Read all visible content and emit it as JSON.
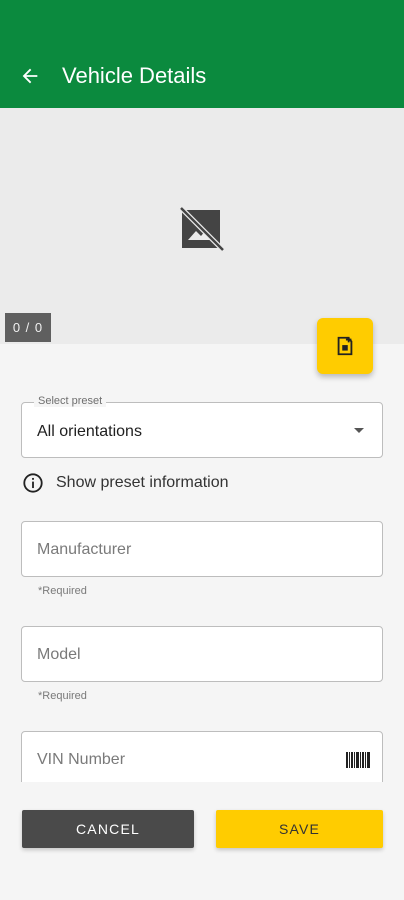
{
  "app_bar": {
    "title": "Vehicle Details",
    "back_icon": "arrow-back-icon",
    "color": "#0b8a3e"
  },
  "gallery": {
    "placeholder_icon": "no-image-icon",
    "counter": "0 / 0",
    "add_photo_icon": "add-photo-icon",
    "fab_color": "#ffcc00"
  },
  "form": {
    "preset": {
      "label": "Select preset",
      "value": "All orientations"
    },
    "preset_info": {
      "icon": "info-icon",
      "label": "Show preset information"
    },
    "manufacturer": {
      "placeholder": "Manufacturer",
      "helper": "*Required"
    },
    "model": {
      "placeholder": "Model",
      "helper": "*Required"
    },
    "vin": {
      "placeholder": "VIN Number",
      "icon": "barcode-icon"
    }
  },
  "actions": {
    "cancel_label": "CANCEL",
    "save_label": "SAVE",
    "accent": "#ffcc00"
  }
}
